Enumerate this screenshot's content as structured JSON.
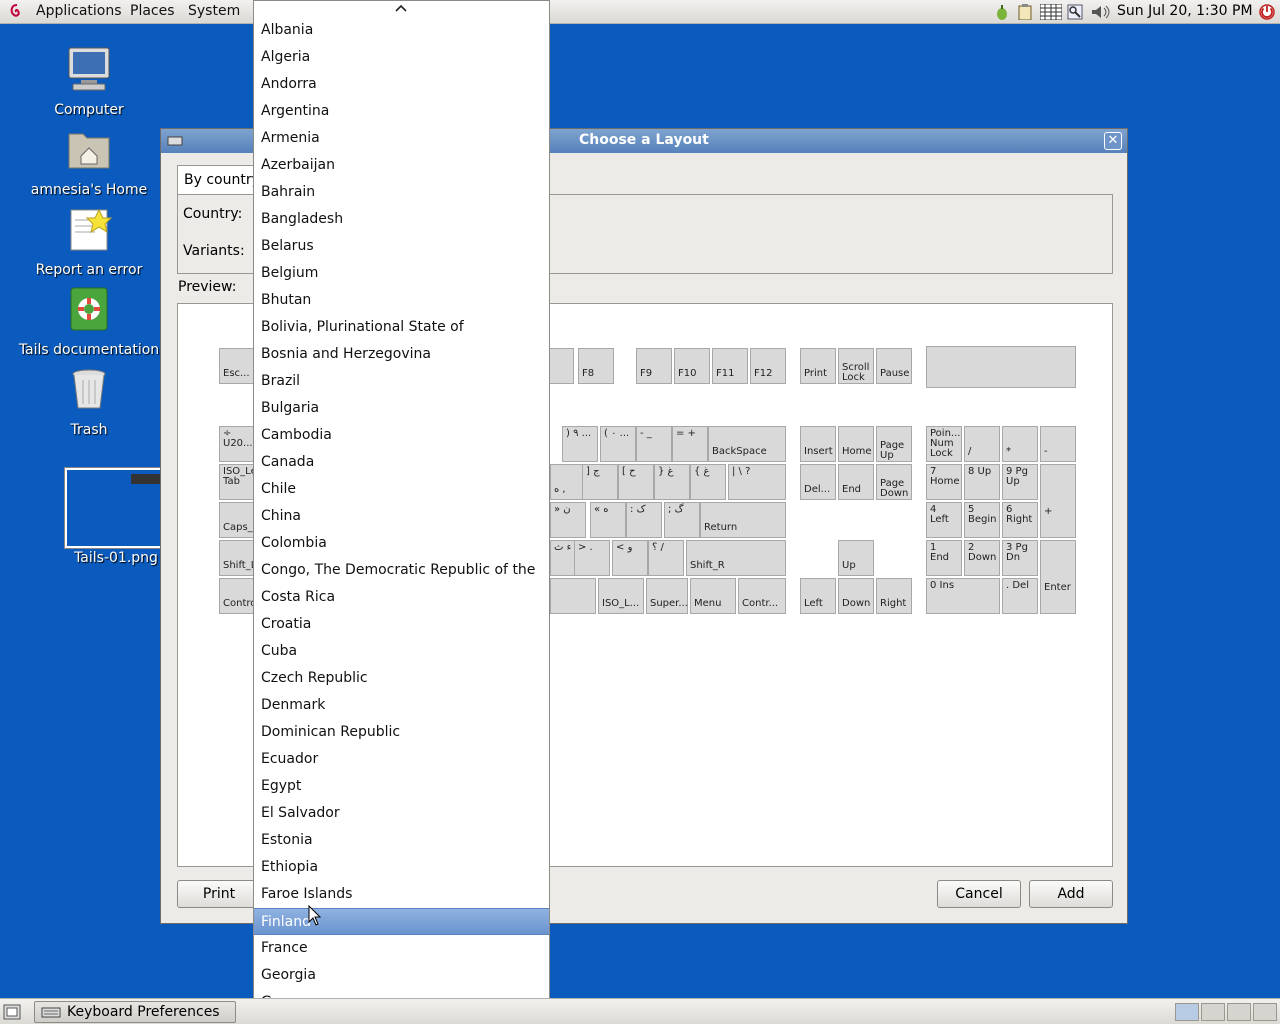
{
  "top_panel": {
    "menus": [
      "Applications",
      "Places",
      "System"
    ],
    "clock": "Sun Jul 20,  1:30 PM",
    "tray_icons": [
      "onion-icon",
      "clipboard-icon",
      "keyboard-grid-icon",
      "key-icon",
      "volume-icon",
      "power-icon"
    ]
  },
  "desktop": {
    "icons": [
      {
        "label": "Computer",
        "icon": "computer-icon"
      },
      {
        "label": "amnesia's Home",
        "icon": "home-folder-icon"
      },
      {
        "label": "Report an error",
        "icon": "report-error-icon"
      },
      {
        "label": "Tails documentation",
        "icon": "lifebuoy-book-icon"
      },
      {
        "label": "Trash",
        "icon": "trash-icon"
      },
      {
        "label": "Tails-01.png",
        "icon": "image-thumbnail-icon"
      }
    ]
  },
  "dialog": {
    "title": "Choose a Layout",
    "tab_label": "By country",
    "country_label": "Country:",
    "variants_label": "Variants:",
    "preview_label": "Preview:",
    "print_label": "Print",
    "cancel_label": "Cancel",
    "add_label": "Add"
  },
  "keyboard_keys": {
    "esc": "Esc...",
    "f7": "7",
    "f8": "F8",
    "f9": "F9",
    "f10": "F10",
    "f11": "F11",
    "f12": "F12",
    "print": "Print",
    "scroll": "Scroll Lock",
    "pause": "Pause",
    "backspace": "BackSpace",
    "insert": "Insert",
    "home": "Home",
    "pageup": "Page Up",
    "numlock": "Poin... Num Lock",
    "numdiv": "/",
    "nummul": "*",
    "numsub": "-",
    "tab": "ISO_Le... Tab",
    "u20": "÷ U20...",
    "del": "Del...",
    "end": "End",
    "pagedown": "Page Down",
    "num7": "7 Home",
    "num8": "8 Up",
    "num9": "9 Pg Up",
    "numadd": "+",
    "caps": "Caps_L...",
    "return": "Return",
    "num4": "4 Left",
    "num5": "5 Begin",
    "num6": "6 Right",
    "shiftl": "Shift_L",
    "shiftr": "Shift_R",
    "up": "Up",
    "num1": "1 End",
    "num2": "2 Down",
    "num3": "3 Pg Dn",
    "enter": "Enter",
    "ctrll": "Contro...",
    "isol": "ISO_L...",
    "super": "Super...",
    "menu": "Menu",
    "ctrlr": "Contr...",
    "left": "Left",
    "down": "Down",
    "right": "Right",
    "num0": "0 Ins",
    "numdel": ". Del",
    "k_paren": "( ٠ ...",
    "k_close": ") ٩ ...",
    "k_minus": "- _",
    "k_eq": "= +",
    "k_brk1": "] ج",
    "k_brk2": "[ ح",
    "k_brc1": "} غ",
    "k_brc2": "{ غ",
    "k_pipe": "| \\ ?",
    "k_q1": "» ن",
    "k_q2": "« ه",
    "k_colon": ": ک",
    "k_semi": "; گ",
    "k_lt": "< و",
    "k_gt": "> .",
    "k_q3": "؟ /",
    "k_ay": "ء ث",
    "k_dot": "ه ,"
  },
  "dropdown": {
    "items": [
      "Albania",
      "Algeria",
      "Andorra",
      "Argentina",
      "Armenia",
      "Azerbaijan",
      "Bahrain",
      "Bangladesh",
      "Belarus",
      "Belgium",
      "Bhutan",
      "Bolivia, Plurinational State of",
      "Bosnia and Herzegovina",
      "Brazil",
      "Bulgaria",
      "Cambodia",
      "Canada",
      "Chile",
      "China",
      "Colombia",
      "Congo, The Democratic Republic of the",
      "Costa Rica",
      "Croatia",
      "Cuba",
      "Czech Republic",
      "Denmark",
      "Dominican Republic",
      "Ecuador",
      "Egypt",
      "El Salvador",
      "Estonia",
      "Ethiopia",
      "Faroe Islands",
      "Finland",
      "France",
      "Georgia",
      "Germany"
    ],
    "selected": "Finland"
  },
  "bottom_panel": {
    "task_label": "Keyboard Preferences",
    "workspaces": 4
  },
  "colors": {
    "desktop": "#0a5bbd",
    "titlebar": "#6b93c7",
    "selection": "#7aa2d8"
  }
}
